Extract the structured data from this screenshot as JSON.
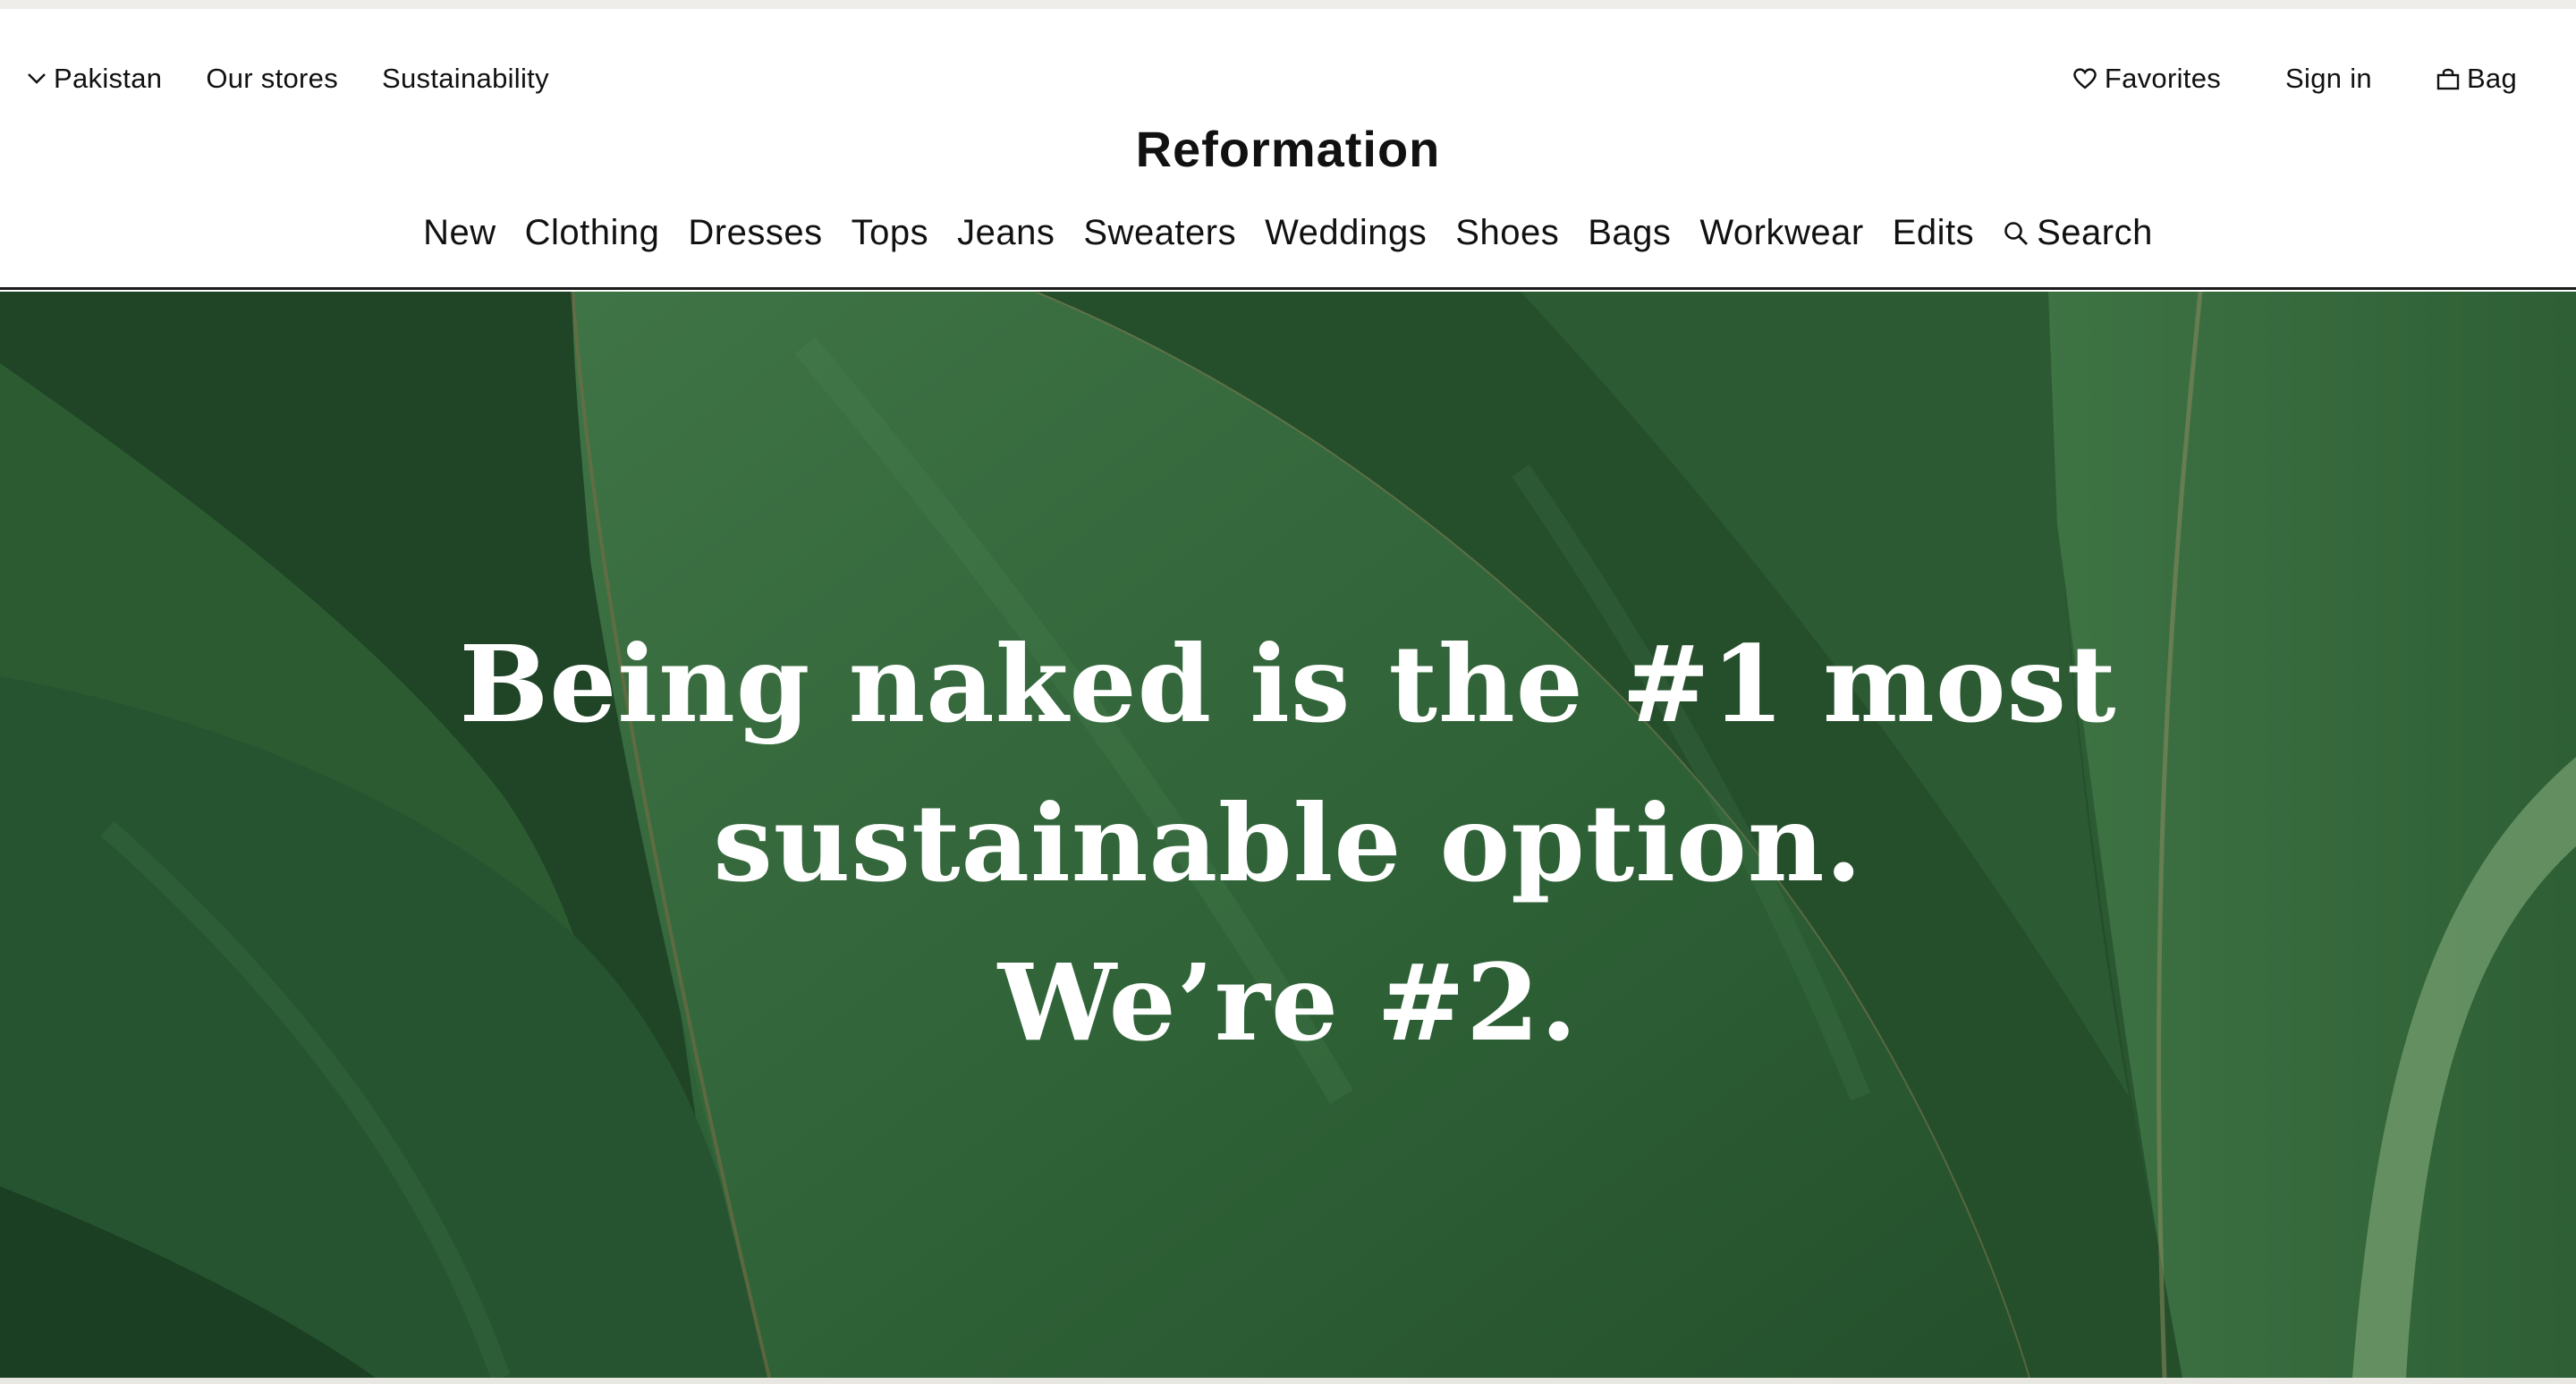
{
  "utility_nav": {
    "region": "Pakistan",
    "stores": "Our stores",
    "sustainability": "Sustainability",
    "favorites": "Favorites",
    "sign_in": "Sign in",
    "bag": "Bag"
  },
  "brand": "Reformation",
  "main_nav": [
    "New",
    "Clothing",
    "Dresses",
    "Tops",
    "Jeans",
    "Sweaters",
    "Weddings",
    "Shoes",
    "Bags",
    "Workwear",
    "Edits"
  ],
  "search_label": "Search",
  "hero": {
    "lines": [
      "Being naked is the #1 most",
      "sustainable option.",
      "We’re #2."
    ]
  },
  "colors": {
    "hero_base": "#2f5f36",
    "leaf_dark": "#1f4526",
    "leaf_mid": "#3c6f43",
    "leaf_light": "#4d8254",
    "text_on_hero": "#ffffff"
  },
  "icons": {
    "region": "chevron-down-icon",
    "favorites": "heart-icon",
    "bag": "shopping-bag-icon",
    "search": "search-icon"
  }
}
